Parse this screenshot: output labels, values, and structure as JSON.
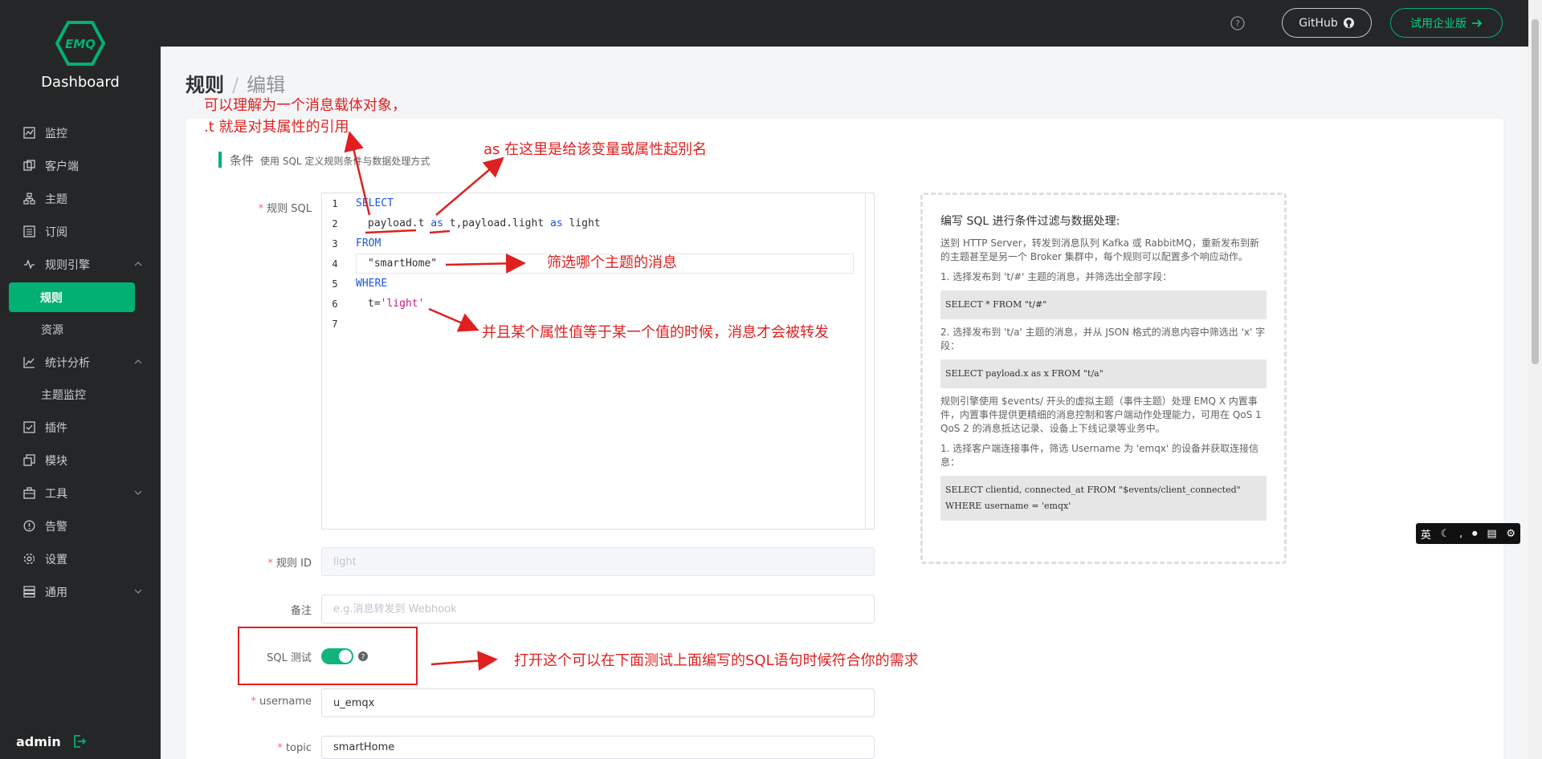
{
  "app": {
    "logo_text": "EMQ",
    "title": "Dashboard"
  },
  "sidebar": {
    "items": [
      {
        "label": "监控",
        "icon": "monitor-icon"
      },
      {
        "label": "客户端",
        "icon": "clients-icon"
      },
      {
        "label": "主题",
        "icon": "topics-icon"
      },
      {
        "label": "订阅",
        "icon": "subscriptions-icon"
      },
      {
        "label": "规则引擎",
        "icon": "rule-engine-icon"
      },
      {
        "label": "统计分析",
        "icon": "analysis-icon"
      },
      {
        "label": "插件",
        "icon": "plugins-icon"
      },
      {
        "label": "模块",
        "icon": "modules-icon"
      },
      {
        "label": "工具",
        "icon": "tools-icon"
      },
      {
        "label": "告警",
        "icon": "alarm-icon"
      },
      {
        "label": "设置",
        "icon": "settings-icon"
      },
      {
        "label": "通用",
        "icon": "general-icon"
      }
    ],
    "rule_engine_sub": [
      "规则",
      "资源"
    ],
    "analysis_sub": [
      "主题监控"
    ],
    "user": "admin"
  },
  "header": {
    "github_label": "GitHub",
    "trial_label": "试用企业版"
  },
  "page": {
    "breadcrumb_root": "规则",
    "breadcrumb_sep": "/",
    "breadcrumb_current": "编辑",
    "section_title": "条件",
    "section_desc": "使用 SQL 定义规则条件与数据处理方式"
  },
  "form": {
    "sql_label": "规则 SQL",
    "id_label": "规则 ID",
    "id_value": "light",
    "note_label": "备注",
    "note_placeholder": "e.g.消息转发到 Webhook",
    "sql_test_label": "SQL 测试",
    "username_label": "username",
    "username_value": "u_emqx",
    "topic_label": "topic",
    "topic_value": "smartHome"
  },
  "editor": {
    "line_numbers": [
      "1",
      "2",
      "3",
      "4",
      "5",
      "6",
      "7"
    ],
    "l1": "SELECT",
    "l2a": "payload.t ",
    "l2b": "as",
    "l2c": " t,payload.light ",
    "l2d": "as",
    "l2e": " light",
    "l3": "FROM",
    "l4": "\"smartHome\"",
    "l5": "WHERE",
    "l6a": "t=",
    "l6b": "'light'"
  },
  "help": {
    "title": "编写 SQL 进行条件过滤与数据处理:",
    "p1": "送到 HTTP Server，转发到消息队列 Kafka 或 RabbitMQ，重新发布到新的主题甚至是另一个 Broker 集群中，每个规则可以配置多个响应动作。",
    "p2": "1. 选择发布到 't/#' 主题的消息，并筛选出全部字段：",
    "c2": "SELECT * FROM \"t/#\"",
    "p3": "2. 选择发布到 't/a' 主题的消息，并从 JSON 格式的消息内容中筛选出 'x' 字段：",
    "c3": "SELECT payload.x as x FROM \"t/a\"",
    "p4": "规则引擎使用 $events/ 开头的虚拟主题（事件主题）处理 EMQ X 内置事件，内置事件提供更精细的消息控制和客户端动作处理能力，可用在 QoS 1 QoS 2 的消息抵达记录、设备上下线记录等业务中。",
    "p5": "1. 选择客户端连接事件，筛选 Username 为 'emqx' 的设备并获取连接信息：",
    "c5a": "SELECT clientid, connected_at FROM \"$events/client_connected\"",
    "c5b": "WHERE username = 'emqx'"
  },
  "annotations": {
    "a1": "可以理解为一个消息载体对象，",
    "a1b": ".t 就是对其属性的引用",
    "a2": "as 在这里是给该变量或属性起别名",
    "a3": "筛选哪个主题的消息",
    "a4": "并且某个属性值等于某一个值的时候，消息才会被转发",
    "a5": "打开这个可以在下面测试上面编写的SQL语句时候符合你的需求"
  },
  "ime": {
    "lang": "英"
  },
  "colors": {
    "accent": "#00b173",
    "sidebar_bg": "#252627",
    "annotation": "#e02020"
  }
}
